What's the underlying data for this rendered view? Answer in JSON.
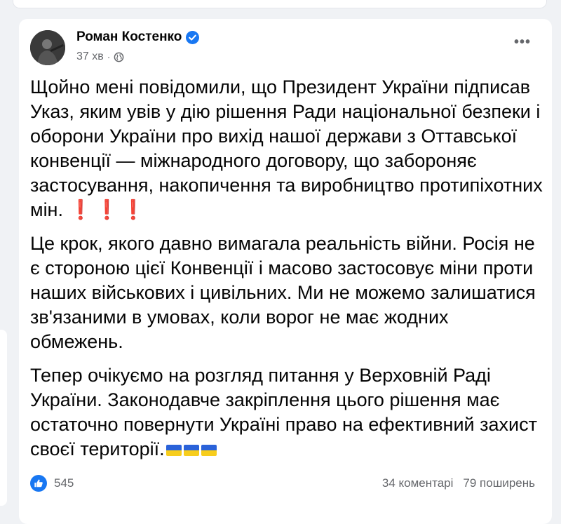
{
  "post": {
    "author": "Роман Костенко",
    "time": "37 хв",
    "meta_separator": "·",
    "paragraphs": [
      "Щойно мені повідомили, що Президент України підписав Указ, яким увів у дію рішення Ради національної безпеки і оборони України про вихід нашої держави з Оттавської конвенції — міжнародного договору, що забороняє застосування, накопичення та виробництво протипіхотних мін.",
      "Це крок, якого давно вимагала реальність війни. Росія не є стороною цієї Конвенції і масово застосовує міни проти наших військових і цивільних. Ми не можемо залишатися зв'язаними в умовах, коли ворог не має жодних обмежень.",
      "Тепер очікуємо на розгляд питання у Верховній Раді України. Законодавче закріплення цього рішення має остаточно повернути Україні право на ефективний захист своєї території."
    ],
    "exclamations": "❗❗❗",
    "reactions_count": "545",
    "comments": "34 коментарі",
    "shares": "79 поширень"
  },
  "icons": {
    "verified": "verified-badge-icon",
    "audience": "globe-icon",
    "more": "more-horizontal-icon",
    "reaction": "like-icon",
    "flag": "ukraine-flag-icon"
  },
  "colors": {
    "accent": "#1877f2",
    "text": "#050505",
    "secondary": "#65676b",
    "background": "#f0f2f5",
    "exclamation": "#e8242b",
    "flag_blue": "#2a62d9",
    "flag_yellow": "#f7cd1c"
  }
}
